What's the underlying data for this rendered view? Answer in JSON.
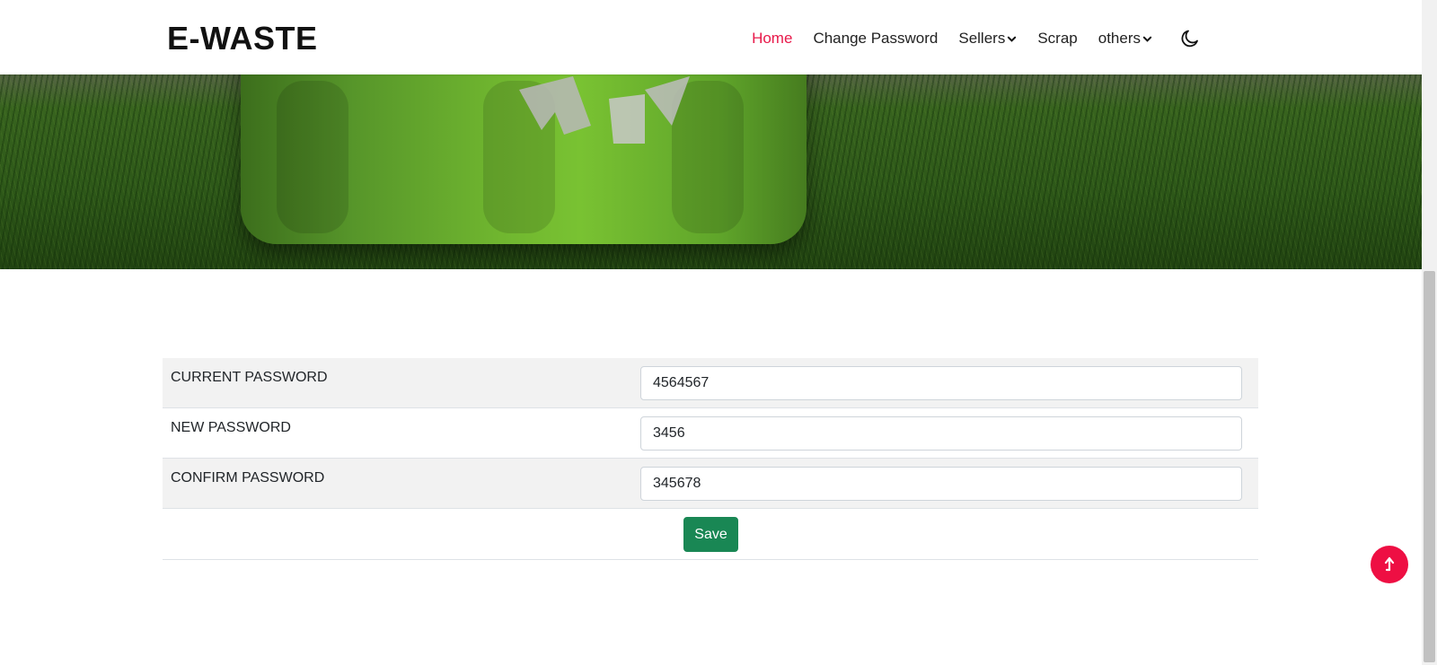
{
  "brand": {
    "title": "E-WASTE"
  },
  "nav": {
    "home": "Home",
    "change_password": "Change Password",
    "sellers": "Sellers",
    "scrap": "Scrap",
    "others": "others"
  },
  "form": {
    "current_password_label": "CURRENT PASSWORD",
    "current_password_value": "4564567",
    "new_password_label": "NEW PASSWORD",
    "new_password_value": "3456",
    "confirm_password_label": "CONFIRM PASSWORD",
    "confirm_password_value": "345678",
    "save_label": "Save"
  },
  "colors": {
    "accent_active": "#e8194a",
    "save_button": "#198754",
    "back_to_top": "#ee0f43"
  },
  "icons": {
    "theme_toggle": "moon-icon",
    "dropdown": "chevron-down-icon",
    "back_to_top": "arrow-up-icon"
  }
}
